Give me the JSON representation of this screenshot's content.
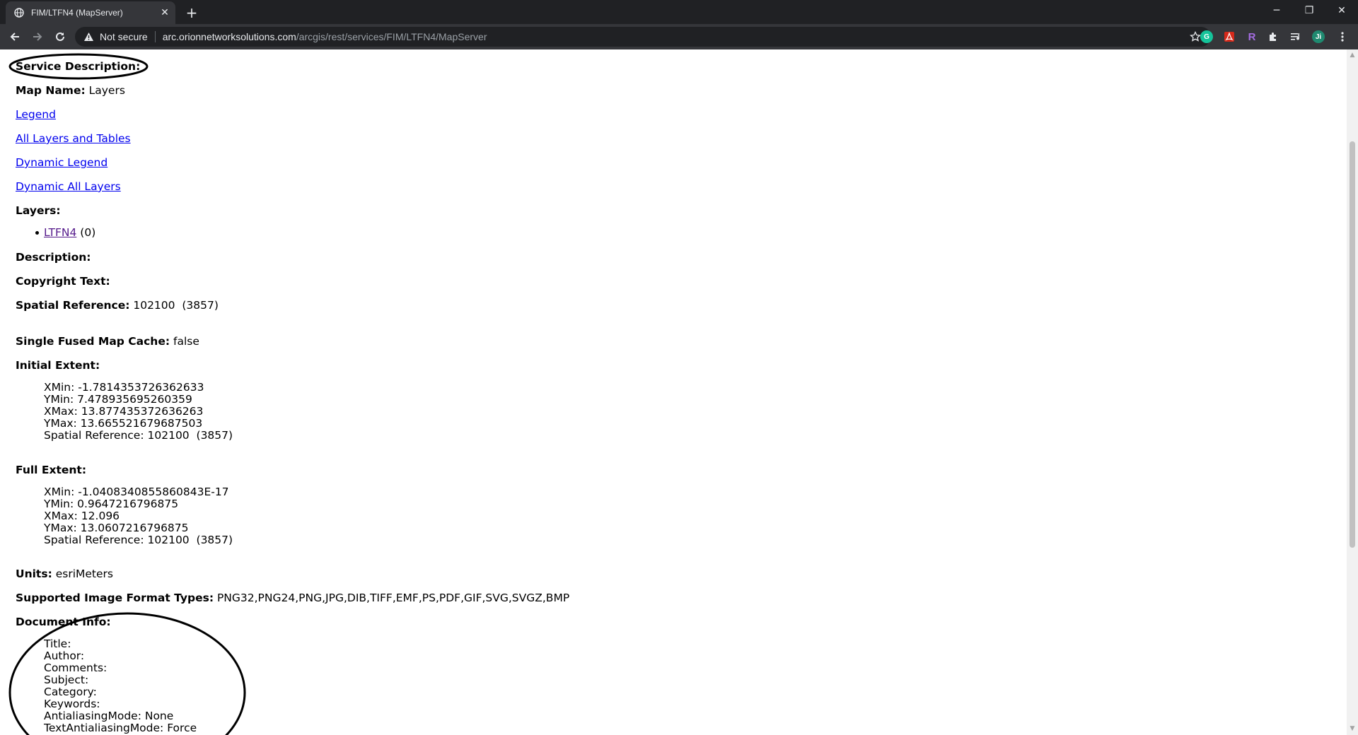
{
  "browser": {
    "tab_title": "FIM/LTFN4 (MapServer)",
    "tab_close": "✕",
    "new_tab": "+",
    "window_controls": {
      "minimize": "─",
      "restore": "❐",
      "close": "✕"
    },
    "security_label": "Not secure",
    "url_host": "arc.orionnetworksolutions.com",
    "url_path": "/arcgis/rest/services/FIM/LTFN4/MapServer",
    "profile_initial": "Ji",
    "extensions": [
      "grammarly-icon",
      "acrobat-icon",
      "r-extension-icon",
      "puzzle-icon",
      "media-icon"
    ],
    "ext_colors": {
      "grammarly": "#15c39a",
      "acrobat": "#d4291a",
      "r": "#8e44ad",
      "profile": "#1f8a70"
    }
  },
  "page": {
    "service_description_label": "Service Description:",
    "map_name_label": "Map Name:",
    "map_name_value": "Layers",
    "links": {
      "legend": "Legend",
      "all_layers": "All Layers and Tables",
      "dynamic_legend": "Dynamic Legend",
      "dynamic_all_layers": "Dynamic All Layers"
    },
    "layers_label": "Layers:",
    "layer_item": {
      "name": "LTFN4",
      "id": "(0)"
    },
    "description_label": "Description:",
    "copyright_label": "Copyright Text:",
    "spatial_ref_label": "Spatial Reference:",
    "spatial_ref_value": "102100  (3857)",
    "fused_cache_label": "Single Fused Map Cache:",
    "fused_cache_value": "false",
    "initial_extent_label": "Initial Extent:",
    "initial_extent": {
      "xmin": "XMin: -1.7814353726362633",
      "ymin": "YMin: 7.478935695260359",
      "xmax": "XMax: 13.877435372636263",
      "ymax": "YMax: 13.665521679687503",
      "sr": "Spatial Reference: 102100  (3857)"
    },
    "full_extent_label": "Full Extent:",
    "full_extent": {
      "xmin": "XMin: -1.0408340855860843E-17",
      "ymin": "YMin: 0.9647216796875",
      "xmax": "XMax: 12.096",
      "ymax": "YMax: 13.0607216796875",
      "sr": "Spatial Reference: 102100  (3857)"
    },
    "units_label": "Units:",
    "units_value": "esriMeters",
    "formats_label": "Supported Image Format Types:",
    "formats_value": "PNG32,PNG24,PNG,JPG,DIB,TIFF,EMF,PS,PDF,GIF,SVG,SVGZ,BMP",
    "doc_info_label": "Document Info:",
    "doc_info": {
      "title": "Title:",
      "author": "Author:",
      "comments": "Comments:",
      "subject": "Subject:",
      "category": "Category:",
      "keywords": "Keywords:",
      "aa_mode": "AntialiasingMode: None",
      "text_aa_mode": "TextAntialiasingMode: Force"
    }
  },
  "colors": {
    "link": "#0000ee",
    "visited_link": "#551a8b",
    "annotation_ink": "#000000"
  }
}
